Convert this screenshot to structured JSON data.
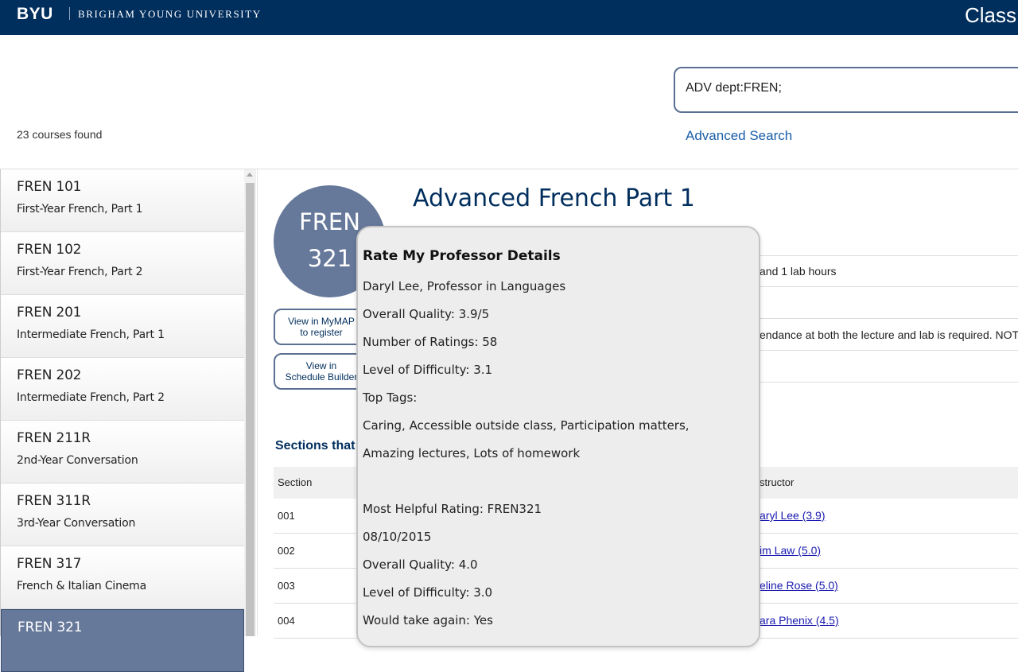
{
  "header": {
    "logo": "BYU",
    "university": "BRIGHAM YOUNG UNIVERSITY",
    "app_title": "Class"
  },
  "search": {
    "value": "ADV dept:FREN;",
    "advanced_link": "Advanced Search"
  },
  "results_count": "23 courses found",
  "courses": [
    {
      "code": "FREN 101",
      "name": "First-Year French, Part 1"
    },
    {
      "code": "FREN 102",
      "name": "First-Year French, Part 2"
    },
    {
      "code": "FREN 201",
      "name": "Intermediate French, Part 1"
    },
    {
      "code": "FREN 202",
      "name": "Intermediate French, Part 2"
    },
    {
      "code": "FREN 211R",
      "name": "2nd-Year Conversation"
    },
    {
      "code": "FREN 311R",
      "name": "3rd-Year Conversation"
    },
    {
      "code": "FREN 317",
      "name": "French & Italian Cinema"
    },
    {
      "code": "FREN 321",
      "name": ""
    }
  ],
  "detail": {
    "badge_dept": "FREN",
    "badge_num": "321",
    "title": "Advanced French Part 1",
    "btn_mymap": "View in MyMAP to register",
    "btn_schedule": "View in Schedule Builder",
    "info_hours": "and 1 lab hours",
    "info_note": "endance at both the lecture and lab is required. NOT",
    "sections_heading": "Sections that m",
    "table": {
      "col_section": "Section",
      "col_instructor": "structor",
      "rows": [
        {
          "section": "001",
          "instructor": "aryl Lee (3.9)"
        },
        {
          "section": "002",
          "instructor": "im Law (5.0)"
        },
        {
          "section": "003",
          "instructor": "eline Rose (5.0)"
        },
        {
          "section": "004",
          "instructor": "ara Phenix (4.5)"
        }
      ]
    }
  },
  "popup": {
    "title": "Rate My Professor Details",
    "professor": "Daryl Lee, Professor in Languages",
    "overall_quality": "Overall Quality: 3.9/5",
    "num_ratings": "Number of Ratings: 58",
    "difficulty": "Level of Difficulty: 3.1",
    "top_tags_label": "Top Tags:",
    "tags_line1": "Caring, Accessible outside class, Participation matters,",
    "tags_line2": "Amazing lectures, Lots of homework",
    "helpful_rating": "Most Helpful Rating: FREN321",
    "rating_date": "08/10/2015",
    "rating_quality": "Overall Quality: 4.0",
    "rating_difficulty": "Level of Difficulty: 3.0",
    "would_take_again": "Would take again: Yes"
  }
}
